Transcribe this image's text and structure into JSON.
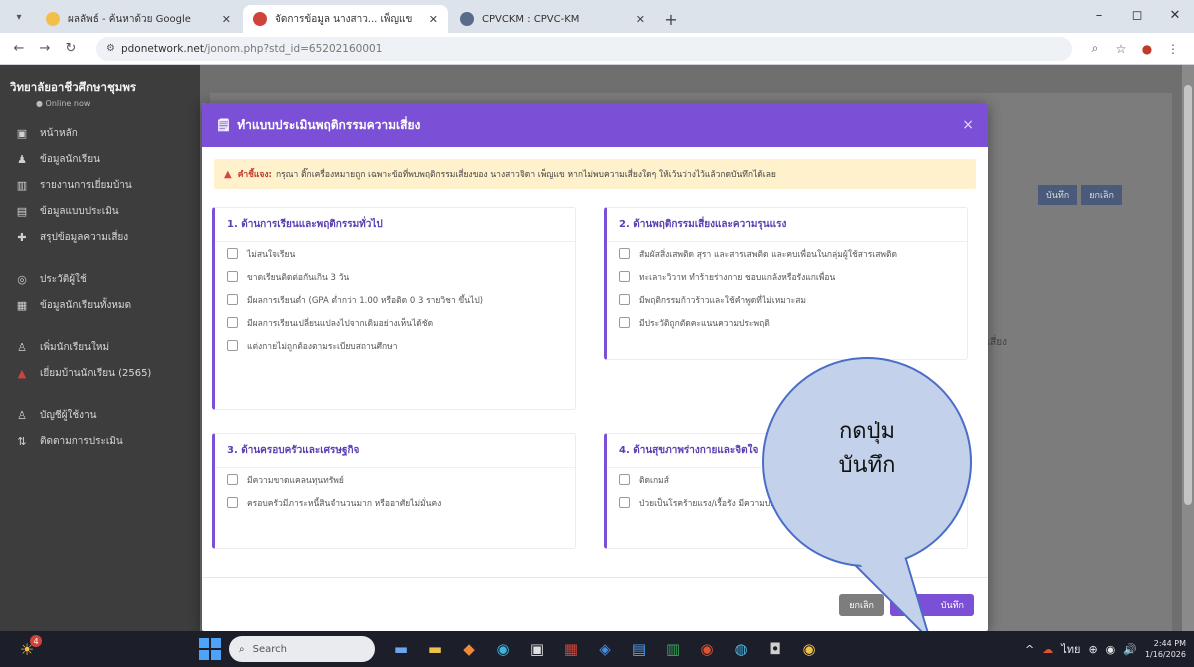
{
  "browser": {
    "tabs": [
      {
        "label": "ผลลัพธ์ - ค้นหาด้วย Google",
        "color": "#f2c04a",
        "active": false
      },
      {
        "label": "จัดการข้อมูล นางสาว... เพ็ญแข",
        "color": "#d0433a",
        "active": true
      },
      {
        "label": "CPVCKM : CPVC-KM",
        "color": "#5a6b8a",
        "active": false
      }
    ],
    "new_tab_symbol": "+",
    "url_domain": "pdonetwork.net",
    "url_path": "/jonom.php?std_id=65202160001",
    "window_controls": [
      "–",
      "◻",
      "✕"
    ]
  },
  "sidebar": {
    "title": "วิทยาลัยอาชีวศึกษาชุมพร",
    "subtitle": "● Online now",
    "items": [
      {
        "icon": "▣",
        "label": "หน้าหลัก"
      },
      {
        "icon": "♟",
        "label": "ข้อมูลนักเรียน"
      },
      {
        "icon": "▥",
        "label": "รายงานการเยี่ยมบ้าน"
      },
      {
        "icon": "▤",
        "label": "ข้อมูลแบบประเมิน"
      },
      {
        "icon": "✚",
        "label": "สรุปข้อมูลความเสี่ยง"
      },
      {
        "icon": "◎",
        "label": "ประวัติผู้ใช้"
      },
      {
        "icon": "▦",
        "label": "ข้อมูลนักเรียนทั้งหมด"
      },
      {
        "icon": "♙",
        "label": "เพิ่มนักเรียนใหม่"
      },
      {
        "icon": "▲",
        "label": "เยี่ยมบ้านนักเรียน (2565)"
      },
      {
        "icon": "♙",
        "label": "บัญชีผู้ใช้งาน"
      },
      {
        "icon": "⇅",
        "label": "ติดตามการประเมิน"
      }
    ]
  },
  "background": {
    "buttons": [
      "บันทึก",
      "ยกเลิก"
    ],
    "text": "ความเสี่ยง"
  },
  "modal": {
    "title": "ทำแบบประเมินพฤติกรรมความเสี่ยง",
    "close_symbol": "×",
    "warning_label": "คำชี้แจง:",
    "warning_text": "กรุณา ติ๊กเครื่องหมายถูก เฉพาะข้อที่พบพฤติกรรมเสี่ยงของ นางสาวจิดา เพ็ญแข หากไม่พบความเสี่ยงใดๆ ให้เว้นว่างไว้แล้วกดบันทึกได้เลย",
    "sections": [
      {
        "title": "1. ด้านการเรียนและพฤติกรรมทั่วไป",
        "items": [
          "ไม่สนใจเรียน",
          "ขาดเรียนติดต่อกันเกิน 3 วัน",
          "มีผลการเรียนต่ำ (GPA ต่ำกว่า 1.00 หรือติด 0 3 รายวิชา ขึ้นไป)",
          "มีผลการเรียนเปลี่ยนแปลงไปจากเดิมอย่างเห็นได้ชัด",
          "แต่งกายไม่ถูกต้องตามระเบียบสถานศึกษา"
        ]
      },
      {
        "title": "2. ด้านพฤติกรรมเสี่ยงและความรุนแรง",
        "items": [
          "สัมผัสสิ่งเสพติด สุรา และสารเสพติด และคบเพื่อนในกลุ่มผู้ใช้สารเสพติด",
          "ทะเลาะวิวาท ทำร้ายร่างกาย ชอบแกล้งหรือรังแกเพื่อน",
          "มีพฤติกรรมก้าวร้าวและใช้คำพูดที่ไม่เหมาะสม",
          "มีประวัติถูกตัดคะแนนความประพฤติ"
        ]
      },
      {
        "title": "3. ด้านครอบครัวและเศรษฐกิจ",
        "items": [
          "มีความขาดแคลนทุนทรัพย์",
          "ครอบครัวมีภาระหนี้สินจำนวนมาก หรืออาศัยไม่มั่นคง"
        ]
      },
      {
        "title": "4. ด้านสุขภาพร่างกายและจิตใจ",
        "items": [
          "ติดเกมส์",
          "ป่วยเป็นโรคร้ายแรง/เรื้อรัง มีความบกพร่องทางร่างกาย"
        ]
      }
    ],
    "cancel_label": "ยกเลิก",
    "save_label": "บันทึก"
  },
  "callout": {
    "line1": "กดปุ่ม",
    "line2": "บันทึก"
  },
  "taskbar": {
    "weather_badge": "4",
    "search_placeholder": "Search",
    "apps": [
      "▬",
      "▬",
      "◆",
      "◉",
      "▣",
      "▦",
      "◈",
      "▤",
      "▥",
      "◉",
      "◍",
      "◘",
      "◉"
    ],
    "tray": [
      "^",
      "☁",
      "ไทย",
      "⊕",
      "◉",
      "🔊"
    ],
    "time": "2:44 PM",
    "date": "1/16/2026"
  }
}
